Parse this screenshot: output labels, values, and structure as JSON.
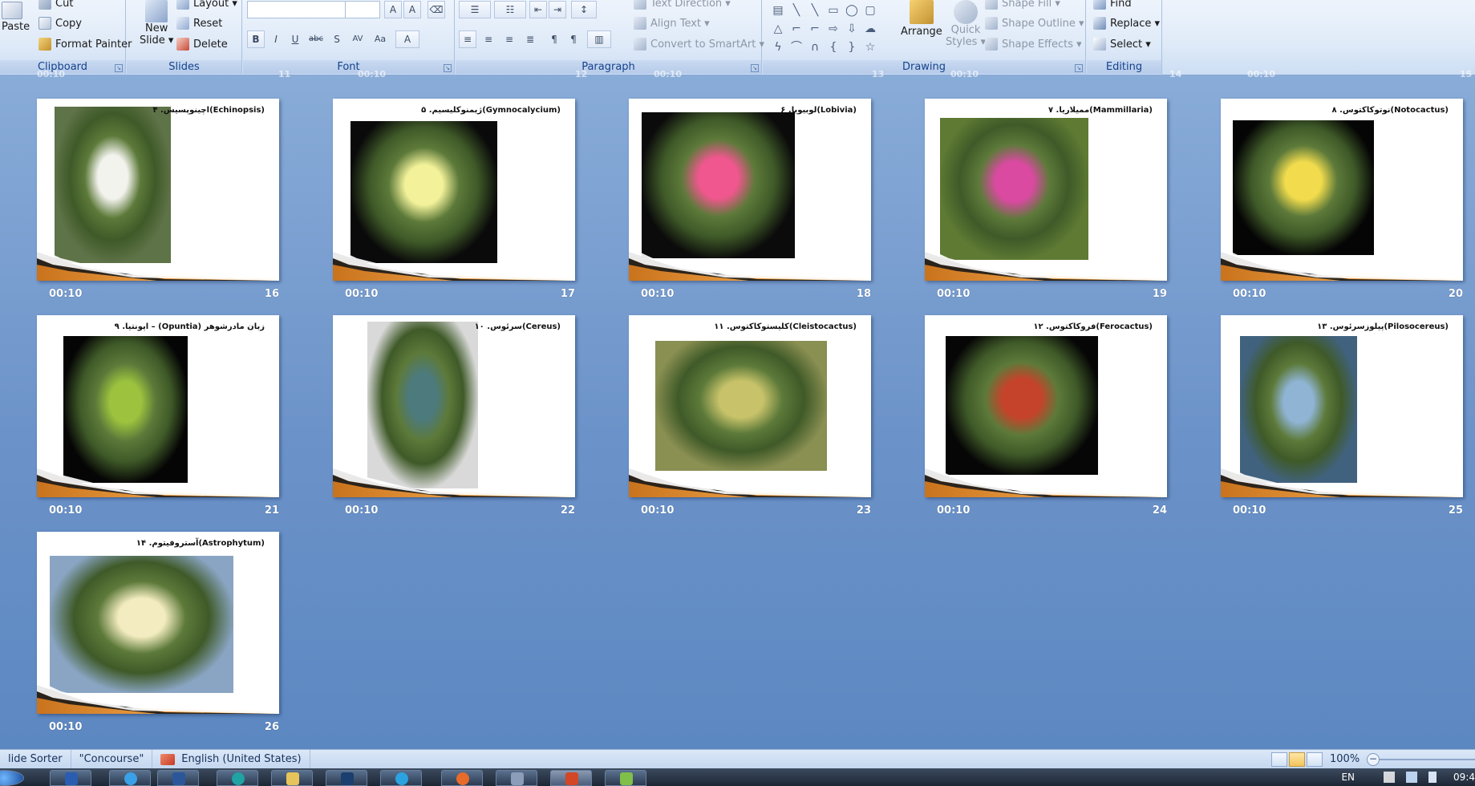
{
  "ribbon": {
    "clipboard": {
      "label": "Clipboard",
      "paste": "Paste",
      "cut": "Cut",
      "copy": "Copy",
      "format_painter": "Format Painter"
    },
    "slides": {
      "label": "Slides",
      "new_slide_line1": "New",
      "new_slide_line2": "Slide ▾",
      "layout": "Layout ▾",
      "reset": "Reset",
      "delete": "Delete"
    },
    "font": {
      "label": "Font"
    },
    "paragraph": {
      "label": "Paragraph",
      "text_direction": "Text Direction ▾",
      "align_text": "Align Text ▾",
      "convert_smartart": "Convert to SmartArt ▾"
    },
    "drawing": {
      "label": "Drawing",
      "arrange": "Arrange",
      "quick_styles_line1": "Quick",
      "quick_styles_line2": "Styles ▾",
      "shape_fill": "Shape Fill ▾",
      "shape_outline": "Shape Outline ▾",
      "shape_effects": "Shape Effects ▾"
    },
    "editing": {
      "label": "Editing",
      "find": "Find",
      "replace": "Replace ▾",
      "select": "Select ▾"
    }
  },
  "ghost_row": {
    "items": [
      "00:10",
      "11",
      "00:10",
      "12",
      "00:10",
      "13",
      "00:10",
      "14",
      "00:10",
      "15"
    ]
  },
  "slides": [
    {
      "num": "16",
      "time": "00:10",
      "title": "۴ .اچینوپسیس(Echinopsis)",
      "photo_bg": "#5f7348",
      "accent": "#f3f3ee"
    },
    {
      "num": "17",
      "time": "00:10",
      "title": "۵ .ژیمنوکلیسیم(Gymnocalycium)",
      "photo_bg": "#0a0a0a",
      "accent": "#f3f29a"
    },
    {
      "num": "18",
      "time": "00:10",
      "title": "۶ .لوبیویا(Lobivia)",
      "photo_bg": "#0b0b0b",
      "accent": "#f0578e"
    },
    {
      "num": "19",
      "time": "00:10",
      "title": "۷ .ممیلاریا(Mammillaria)",
      "photo_bg": "#5e7a33",
      "accent": "#d94aa0"
    },
    {
      "num": "20",
      "time": "00:10",
      "title": "۸ .نوتوکاکتوس(Notocactus)",
      "photo_bg": "#050505",
      "accent": "#f2dc4d"
    },
    {
      "num": "21",
      "time": "00:10",
      "title": "۹ .اپونتیا – (Opuntia) زبان مادرشوهر",
      "photo_bg": "#050505",
      "accent": "#9cc23e"
    },
    {
      "num": "22",
      "time": "00:10",
      "title": "۱۰ .سرئوس(Cereus)",
      "photo_bg": "#d9d9d9",
      "accent": "#4d7a7c"
    },
    {
      "num": "23",
      "time": "00:10",
      "title": "۱۱ .کلیستوکاکتوس(Cleistocactus)",
      "photo_bg": "#8a8f52",
      "accent": "#c8c36a"
    },
    {
      "num": "24",
      "time": "00:10",
      "title": "۱۲ .فروکاکتوس(Ferocactus)",
      "photo_bg": "#060606",
      "accent": "#c5432a"
    },
    {
      "num": "25",
      "time": "00:10",
      "title": "۱۳ .پیلوزسرئوس(Pilosocereus)",
      "photo_bg": "#41627f",
      "accent": "#8fb4d4"
    },
    {
      "num": "26",
      "time": "00:10",
      "title": "۱۴ .آستروفیتوم(Astrophytum)",
      "photo_bg": "#8aa5c3",
      "accent": "#f3ecc0"
    }
  ],
  "statusbar": {
    "view": "lide Sorter",
    "theme": "\"Concourse\"",
    "language": "English (United States)",
    "zoom": "100%",
    "zoom_minus": "−"
  },
  "taskbar": {
    "lang": "EN",
    "clock": "09:4"
  }
}
